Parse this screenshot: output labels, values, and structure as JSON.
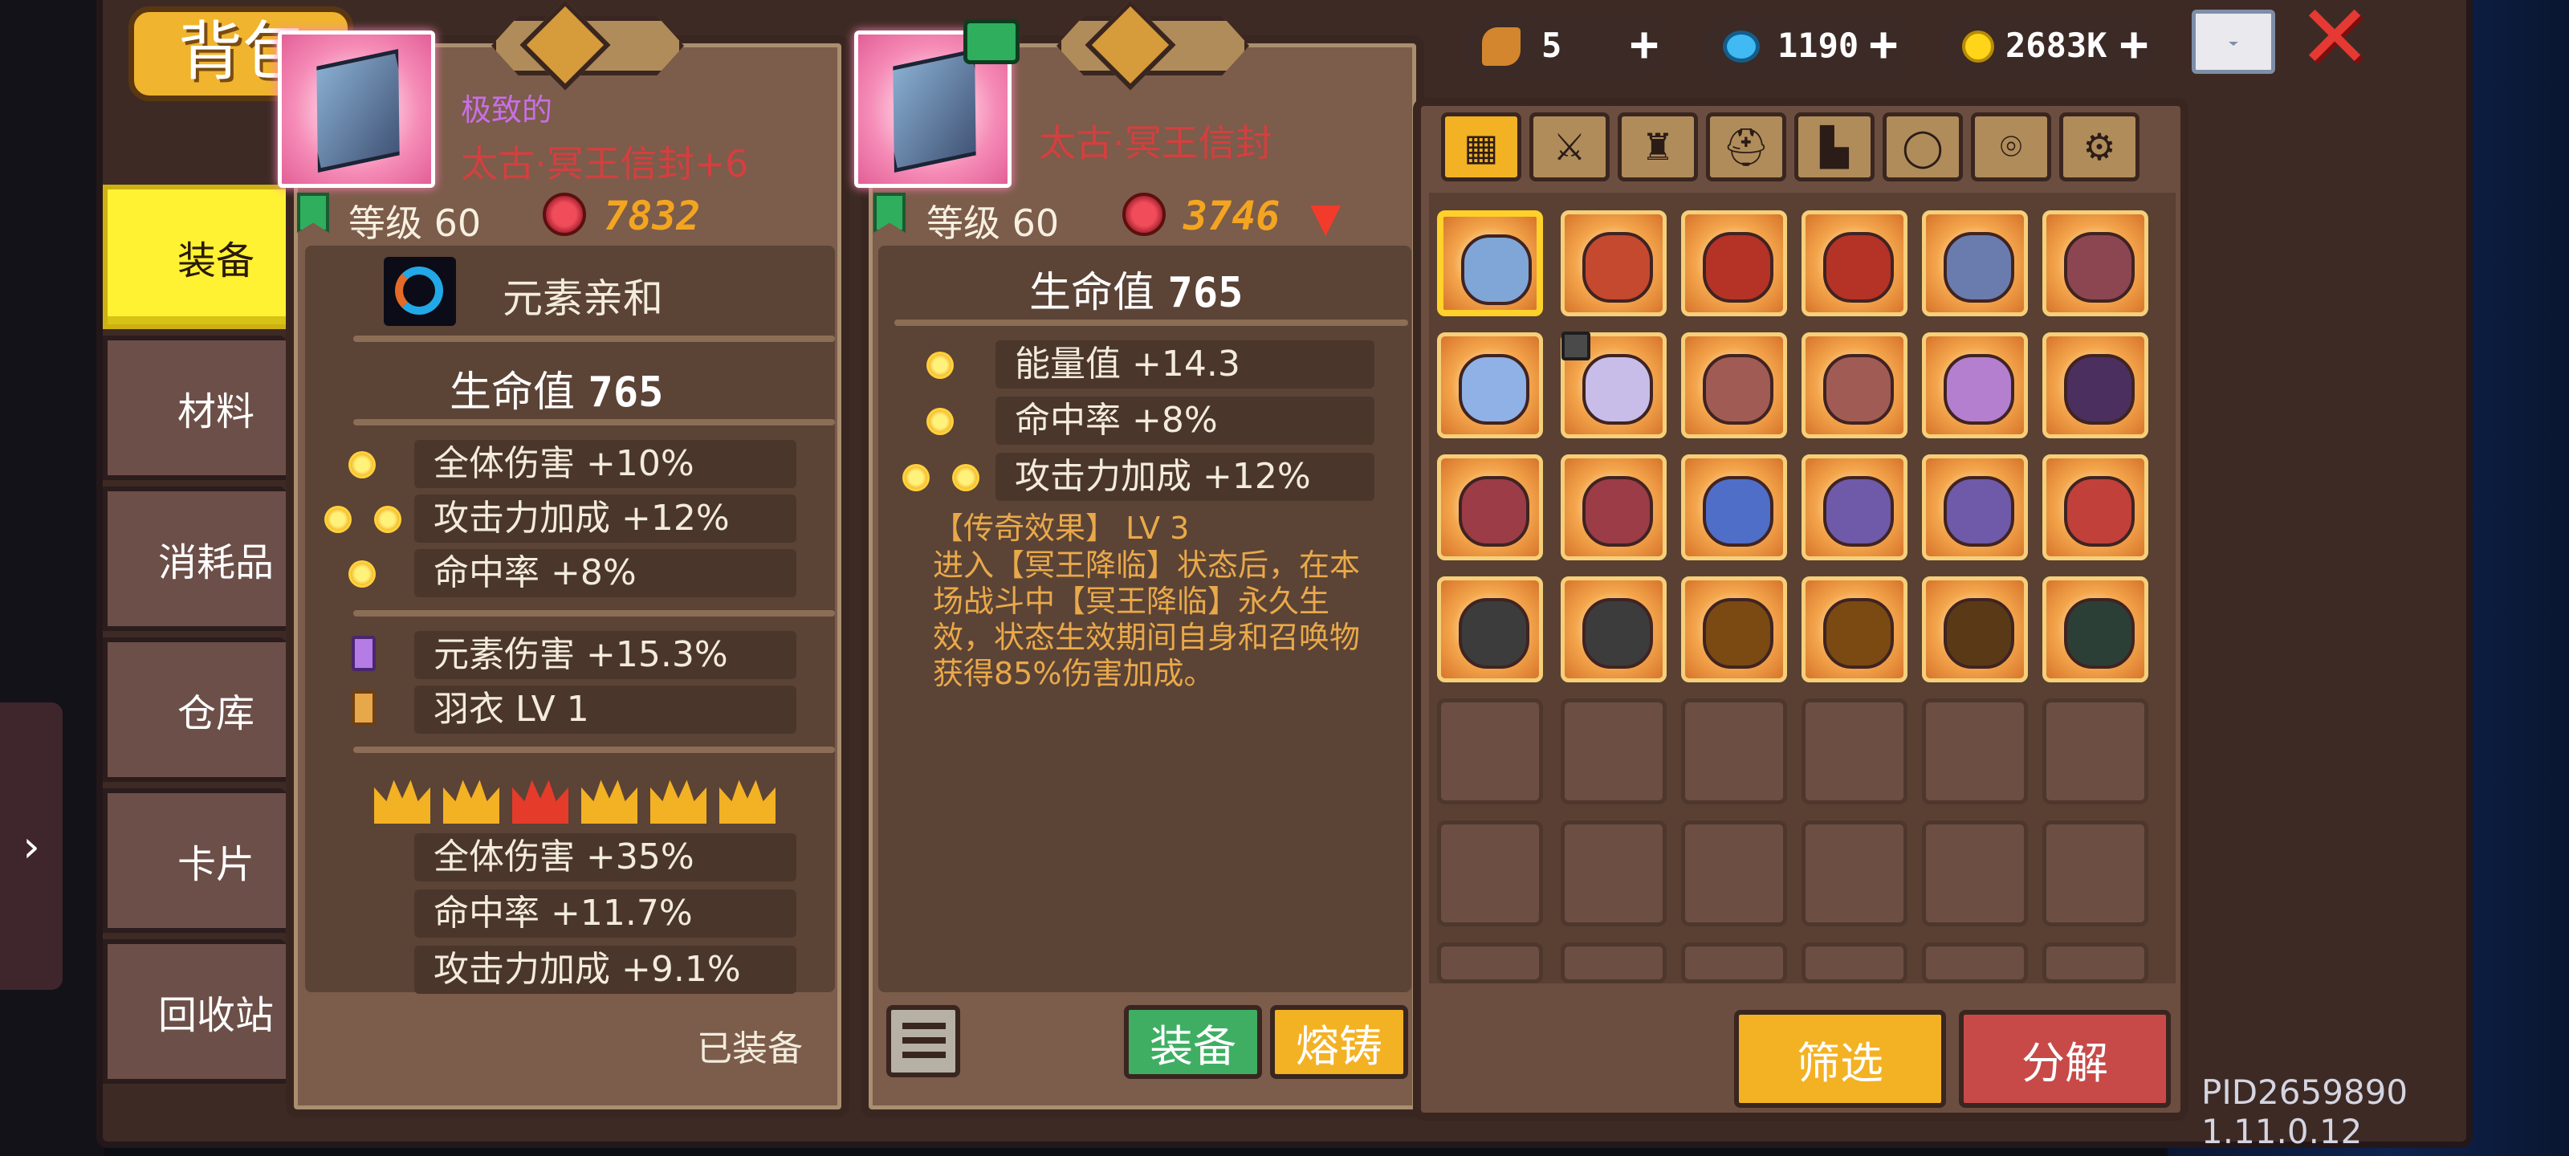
{
  "header": {
    "title": "背包"
  },
  "resources": [
    {
      "icon": "hammer-icon",
      "value": "5",
      "plus": "+"
    },
    {
      "icon": "gem-icon",
      "value": "1190",
      "plus": "+"
    },
    {
      "icon": "coin-icon",
      "value": "2683K",
      "plus": "+"
    }
  ],
  "sidebar": {
    "tabs": [
      "装备",
      "材料",
      "消耗品",
      "仓库",
      "卡片",
      "回收站"
    ]
  },
  "colors": {
    "accent": "#f3b124",
    "panel": "#7c5c4a",
    "legendary": "#d43f3f"
  },
  "left_card": {
    "rarity": "极致的",
    "name": "太古·冥王信封+6",
    "level": "等级 60",
    "power": "7832",
    "element": "元素亲和",
    "hp_label": "生命值",
    "hp_value": "765",
    "stats": [
      "全体伤害 +10%",
      "攻击力加成 +12%",
      "命中率 +8%"
    ],
    "enchants": [
      "元素伤害 +15.3%",
      "羽衣 LV 1"
    ],
    "crown_count": 6,
    "crown_bonuses": [
      "全体伤害 +35%",
      "命中率 +11.7%",
      "攻击力加成 +9.1%"
    ],
    "equipped": "已装备"
  },
  "right_card": {
    "name": "太古·冥王信封",
    "level": "等级 60",
    "power": "3746",
    "hp_label": "生命值",
    "hp_value": "765",
    "stats": [
      "能量值 +14.3",
      "命中率 +8%",
      "攻击力加成 +12%"
    ],
    "trait_title": "【传奇效果】 LV 3",
    "trait_lines": [
      "进入【冥王降临】状态后，在本",
      "场战斗中【冥王降临】永久生",
      "效，状态生效期间自身和召唤物",
      "获得85%伤害加成。"
    ],
    "buttons": {
      "equip": "装备",
      "forge": "熔铸"
    }
  },
  "inventory": {
    "filter_tabs": [
      "grid-icon",
      "sword-icon",
      "armor-icon",
      "helmet-icon",
      "boots-icon",
      "ring-icon",
      "amulet-icon",
      "gear-icon"
    ],
    "items_row1": [
      "envelope",
      "demon",
      "flame",
      "flame",
      "scroll",
      "scroll"
    ],
    "items_row2": [
      "ice-wing",
      "ice-wing",
      "tome",
      "tome",
      "orb",
      "dark-wing"
    ],
    "items_row3": [
      "spiked-shield",
      "spiked-shield",
      "ocean-shell",
      "ocean-shell",
      "ocean-shell",
      "fire-shell"
    ],
    "items_row4": [
      "knight-helm",
      "knight-helm",
      "gold-helm",
      "gold-helm",
      "gold-helm",
      "gold-amulet"
    ],
    "buttons": {
      "filter": "筛选",
      "decompose": "分解"
    }
  },
  "footer": {
    "pid": "PID2659890 1.11.0.12"
  }
}
